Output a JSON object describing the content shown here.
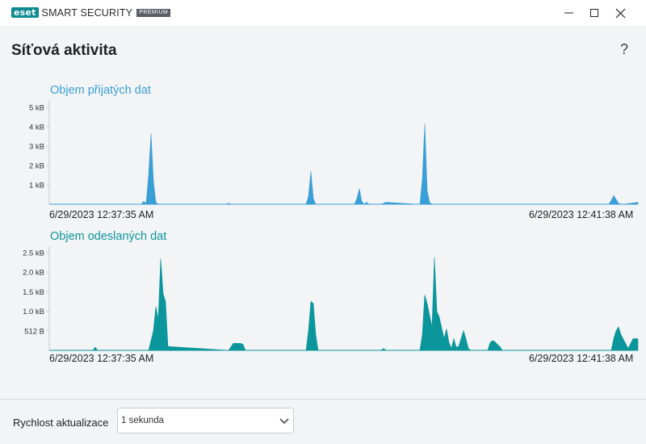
{
  "window": {
    "brand": "eset",
    "product": "SMART SECURITY",
    "edition": "PREMIUM",
    "controls": [
      "minimize-icon",
      "maximize-icon",
      "close-icon"
    ]
  },
  "page": {
    "title": "Síťová aktivita",
    "help_label": "?"
  },
  "chart_data": [
    {
      "type": "area",
      "title": "Objem přijatých dat",
      "color": "#3a9fd6",
      "ylim": [
        0,
        5
      ],
      "yunit": "kB",
      "yticks": [
        {
          "value": 5,
          "label": "5 kB"
        },
        {
          "value": 4,
          "label": "4 kB"
        },
        {
          "value": 3,
          "label": "3 kB"
        },
        {
          "value": 2,
          "label": "2 kB"
        },
        {
          "value": 1,
          "label": "1 kB"
        }
      ],
      "x_start_label": "6/29/2023 12:37:35 AM",
      "x_end_label": "6/29/2023 12:41:38 AM",
      "x_seconds_range": [
        0,
        243
      ],
      "series": [
        {
          "x": [
            0,
            38,
            39,
            40,
            41,
            42,
            43,
            44,
            45,
            73,
            74,
            75,
            106,
            107,
            108,
            109,
            110,
            111,
            126,
            127,
            128,
            129,
            130,
            131,
            132,
            137,
            139,
            152,
            153,
            154,
            155,
            156,
            157,
            158,
            231,
            232,
            233,
            235,
            236,
            237,
            243
          ],
          "y": [
            0,
            0,
            0.15,
            0.05,
            1.5,
            3.65,
            1.2,
            0.1,
            0,
            0,
            0.05,
            0,
            0,
            0.4,
            1.7,
            0.3,
            0,
            0,
            0,
            0.3,
            0.8,
            0.15,
            0,
            0.1,
            0,
            0,
            0.1,
            0,
            0,
            1.3,
            4.15,
            0.7,
            0.1,
            0,
            0,
            0.2,
            0.45,
            0.05,
            0,
            0,
            0.1
          ]
        }
      ]
    },
    {
      "type": "area",
      "title": "Objem odeslaných dat",
      "color": "#0a969b",
      "ylim": [
        0,
        2.5
      ],
      "yunit": "kB",
      "yticks": [
        {
          "value": 2.5,
          "label": "2.5 kB"
        },
        {
          "value": 2.0,
          "label": "2.0 kB"
        },
        {
          "value": 1.5,
          "label": "1.5 kB"
        },
        {
          "value": 1.0,
          "label": "1.0 kB"
        },
        {
          "value": 0.5,
          "label": "512 B"
        }
      ],
      "x_start_label": "6/29/2023 12:37:35 AM",
      "x_end_label": "6/29/2023 12:41:38 AM",
      "x_seconds_range": [
        0,
        243
      ],
      "series": [
        {
          "x": [
            0,
            18,
            19,
            20,
            41,
            43,
            44,
            45,
            46,
            47,
            48,
            49,
            74,
            76,
            77,
            78,
            79,
            80,
            81,
            106,
            107,
            108,
            109,
            110,
            111,
            137,
            138,
            139,
            153,
            154,
            155,
            156,
            158,
            159,
            160,
            161,
            163,
            164,
            165,
            166,
            167,
            168,
            169,
            170,
            171,
            172,
            173,
            174,
            175,
            176,
            181,
            182,
            183,
            184,
            185,
            186,
            187,
            232,
            233,
            234,
            235,
            236,
            239,
            241,
            243
          ],
          "y": [
            0,
            0,
            0.08,
            0,
            0,
            0.5,
            1.12,
            0.8,
            2.35,
            1.45,
            1.25,
            0.1,
            0,
            0.18,
            0.18,
            0.18,
            0.18,
            0.15,
            0,
            0,
            0.5,
            1.25,
            1.2,
            0.4,
            0,
            0,
            0.05,
            0,
            0,
            0.4,
            1.42,
            1.2,
            0.6,
            2.38,
            1.0,
            0.85,
            0.3,
            0.55,
            0.2,
            0.05,
            0.3,
            0.08,
            0.1,
            0.3,
            0.5,
            0.3,
            0.05,
            0,
            0,
            0,
            0,
            0.2,
            0.25,
            0.22,
            0.15,
            0.1,
            0,
            0,
            0.3,
            0.5,
            0.6,
            0.4,
            0.05,
            0.3,
            0.3
          ]
        }
      ]
    }
  ],
  "footer": {
    "speed_label": "Rychlost aktualizace",
    "speed_value": "1 sekunda"
  }
}
